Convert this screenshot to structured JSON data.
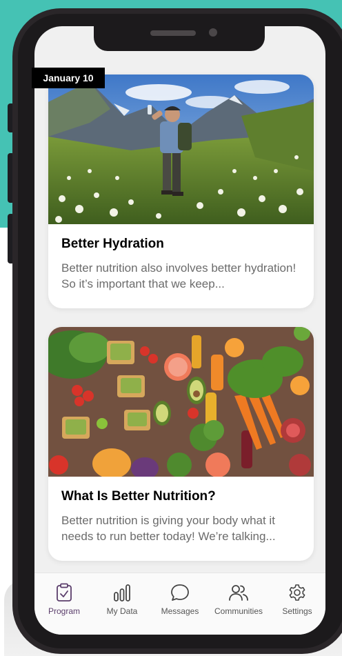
{
  "feed": {
    "date_label": "January 10",
    "cards": [
      {
        "title": "Better Hydration",
        "description": "Better nutrition also involves better hydration! So it’s important that we keep..."
      },
      {
        "title": "What Is Better Nutrition?",
        "description": "Better nutrition is giving your body what it needs to run better today! We’re talking..."
      }
    ]
  },
  "tabbar": {
    "items": [
      {
        "label": "Program",
        "icon": "clipboard-check-icon",
        "active": true
      },
      {
        "label": "My Data",
        "icon": "bar-chart-icon",
        "active": false
      },
      {
        "label": "Messages",
        "icon": "chat-bubble-icon",
        "active": false
      },
      {
        "label": "Communities",
        "icon": "people-icon",
        "active": false
      },
      {
        "label": "Settings",
        "icon": "gear-icon",
        "active": false
      }
    ]
  },
  "colors": {
    "background_accent": "#45c2b4",
    "active_tab": "#5a3d6b",
    "date_tag": "#000000"
  }
}
